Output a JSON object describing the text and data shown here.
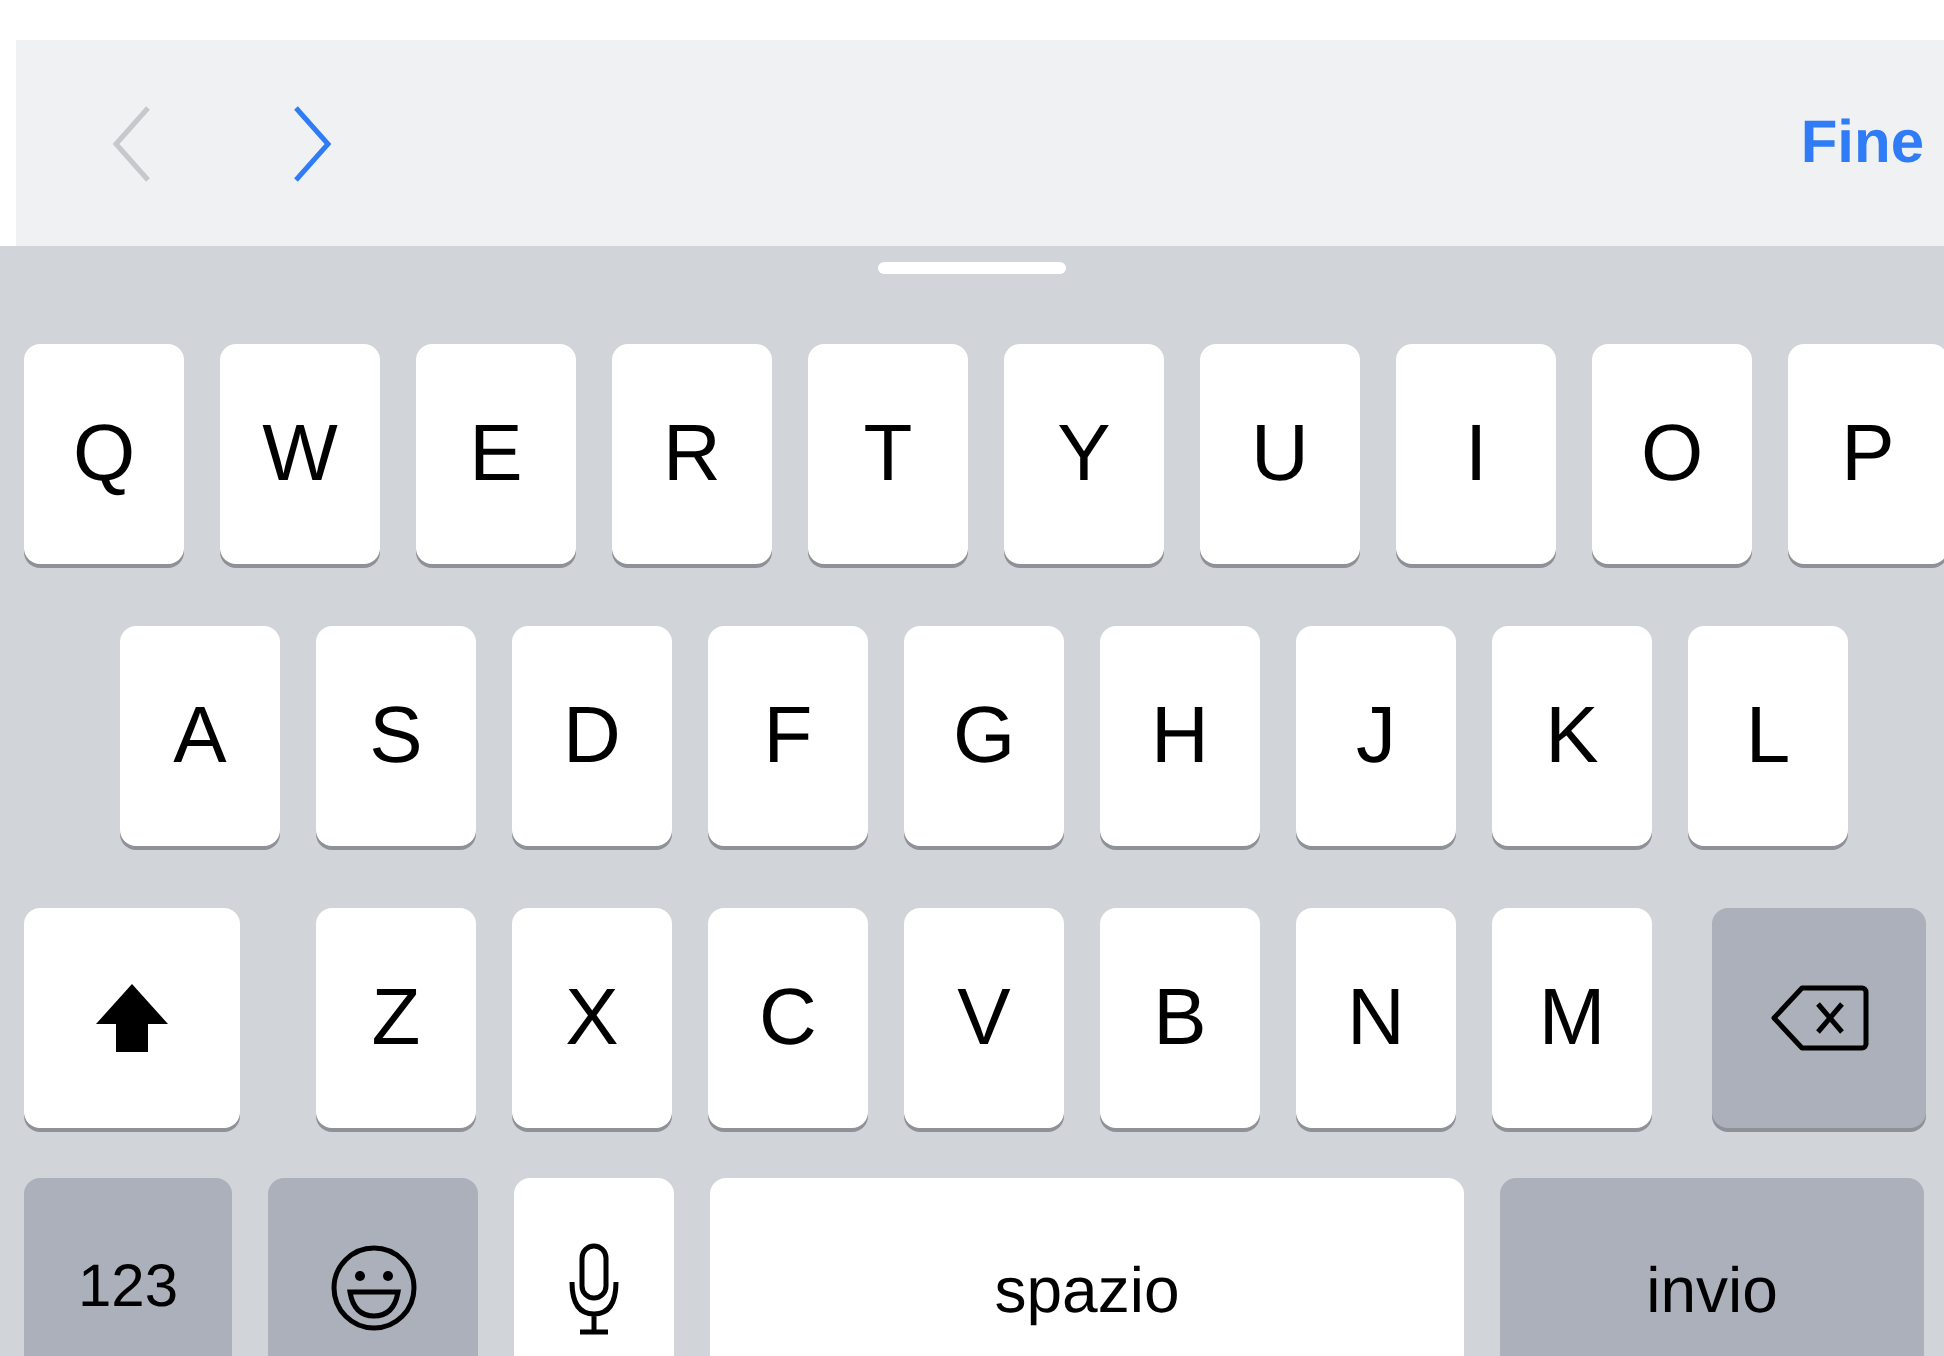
{
  "toolbar": {
    "previous": {
      "disabled": true
    },
    "next": {
      "disabled": false
    },
    "done": "Fine"
  },
  "rows": [
    [
      {
        "kind": "letter",
        "label": "Q"
      },
      {
        "kind": "letter",
        "label": "W"
      },
      {
        "kind": "letter",
        "label": "E"
      },
      {
        "kind": "letter",
        "label": "R"
      },
      {
        "kind": "letter",
        "label": "T"
      },
      {
        "kind": "letter",
        "label": "Y"
      },
      {
        "kind": "letter",
        "label": "U"
      },
      {
        "kind": "letter",
        "label": "I"
      },
      {
        "kind": "letter",
        "label": "O"
      },
      {
        "kind": "letter",
        "label": "P"
      }
    ],
    [
      {
        "kind": "letter",
        "label": "A"
      },
      {
        "kind": "letter",
        "label": "S"
      },
      {
        "kind": "letter",
        "label": "D"
      },
      {
        "kind": "letter",
        "label": "F"
      },
      {
        "kind": "letter",
        "label": "G"
      },
      {
        "kind": "letter",
        "label": "H"
      },
      {
        "kind": "letter",
        "label": "J"
      },
      {
        "kind": "letter",
        "label": "K"
      },
      {
        "kind": "letter",
        "label": "L"
      }
    ],
    [
      {
        "kind": "shift"
      },
      {
        "kind": "letter",
        "label": "Z"
      },
      {
        "kind": "letter",
        "label": "X"
      },
      {
        "kind": "letter",
        "label": "C"
      },
      {
        "kind": "letter",
        "label": "V"
      },
      {
        "kind": "letter",
        "label": "B"
      },
      {
        "kind": "letter",
        "label": "N"
      },
      {
        "kind": "letter",
        "label": "M"
      },
      {
        "kind": "backspace"
      }
    ],
    [
      {
        "kind": "numbers",
        "label": "123"
      },
      {
        "kind": "emoji"
      },
      {
        "kind": "mic"
      },
      {
        "kind": "space",
        "label": "spazio"
      },
      {
        "kind": "return",
        "label": "invio"
      }
    ]
  ]
}
